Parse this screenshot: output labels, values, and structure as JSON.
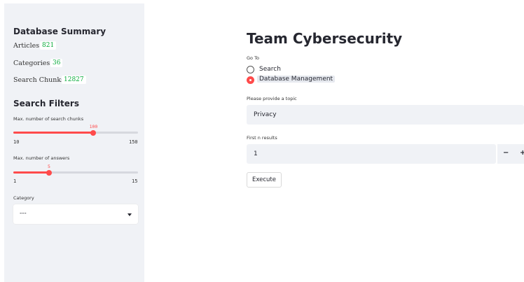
{
  "sidebar": {
    "summary": {
      "heading": "Database Summary",
      "articles_label": "Articles:",
      "articles_value": "821",
      "categories_label": "Categories:",
      "categories_value": "36",
      "chunks_label": "Search Chunks:",
      "chunks_value": "12827"
    },
    "filters": {
      "heading": "Search Filters",
      "chunks_slider": {
        "label": "Max. number of search chunks",
        "value": "100",
        "min": "10",
        "max": "150",
        "fraction": 0.643
      },
      "answers_slider": {
        "label": "Max. number of answers",
        "value": "5",
        "min": "1",
        "max": "15",
        "fraction": 0.286
      },
      "category": {
        "label": "Category",
        "selected": "---"
      }
    }
  },
  "main": {
    "title": "Team Cybersecurity",
    "goto": {
      "label": "Go To",
      "options": [
        "Search",
        "Database Management"
      ],
      "selected": "Database Management"
    },
    "topic": {
      "label": "Please provide a topic",
      "value": "Privacy"
    },
    "first_n": {
      "label": "First n results",
      "value": "1",
      "decrement": "−"
    },
    "execute_label": "Execute"
  },
  "colors": {
    "accent": "#ff4b4b",
    "value_green": "#09ab3b",
    "sidebar_bg": "#f0f2f6"
  }
}
